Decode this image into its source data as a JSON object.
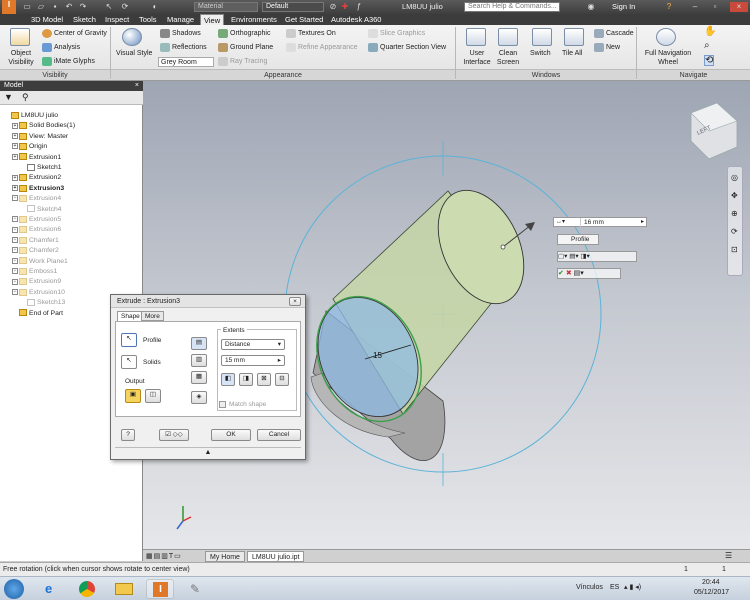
{
  "titlebar": {
    "style_field": "Material",
    "appearance_field": "Default",
    "doc_title": "LM8UU julio",
    "search_placeholder": "Search Help & Commands...",
    "sign_in": "Sign In",
    "help": "?"
  },
  "menu_tabs": [
    "3D Model",
    "Sketch",
    "Inspect",
    "Tools",
    "Manage",
    "View",
    "Environments",
    "Get Started",
    "Autodesk A360"
  ],
  "active_tab": "View",
  "ribbon": {
    "visibility": {
      "object_visibility": "Object Visibility",
      "center_of_gravity": "Center of Gravity",
      "analysis": "Analysis",
      "imate_glyphs": "iMate Glyphs",
      "label": "Visibility"
    },
    "appearance": {
      "visual_style": "Visual Style",
      "shadows": "Shadows",
      "reflections": "Reflections",
      "grey_room": "Grey Room",
      "orthographic": "Orthographic",
      "ground_plane": "Ground Plane",
      "ray_tracing": "Ray Tracing",
      "textures_on": "Textures On",
      "refine_appearance": "Refine Appearance",
      "slice_graphics": "Slice Graphics",
      "quarter_section_view": "Quarter Section View",
      "label": "Appearance"
    },
    "windows": {
      "user_interface": "User Interface",
      "clean_screen": "Clean Screen",
      "switch": "Switch",
      "tile_all": "Tile All",
      "cascade": "Cascade",
      "new": "New",
      "label": "Windows"
    },
    "navigate": {
      "full_navigation_wheel": "Full Navigation Wheel",
      "label": "Navigate"
    }
  },
  "browser": {
    "title": "Model",
    "items": [
      {
        "label": "LM8UU julio",
        "depth": 0,
        "style": "normal"
      },
      {
        "label": "Solid Bodies(1)",
        "depth": 1,
        "style": "normal"
      },
      {
        "label": "View: Master",
        "depth": 1,
        "style": "normal"
      },
      {
        "label": "Origin",
        "depth": 1,
        "style": "normal"
      },
      {
        "label": "Extrusion1",
        "depth": 1,
        "style": "normal"
      },
      {
        "label": "Sketch1",
        "depth": 2,
        "style": "normal"
      },
      {
        "label": "Extrusion2",
        "depth": 1,
        "style": "normal"
      },
      {
        "label": "Extrusion3",
        "depth": 1,
        "style": "bold"
      },
      {
        "label": "Extrusion4",
        "depth": 1,
        "style": "dim"
      },
      {
        "label": "Sketch4",
        "depth": 2,
        "style": "dim"
      },
      {
        "label": "Extrusion5",
        "depth": 1,
        "style": "dim"
      },
      {
        "label": "Extrusion6",
        "depth": 1,
        "style": "dim"
      },
      {
        "label": "Chamfer1",
        "depth": 1,
        "style": "dim"
      },
      {
        "label": "Chamfer2",
        "depth": 1,
        "style": "dim"
      },
      {
        "label": "Work Plane1",
        "depth": 1,
        "style": "dim"
      },
      {
        "label": "Emboss1",
        "depth": 1,
        "style": "dim"
      },
      {
        "label": "Extrusion9",
        "depth": 1,
        "style": "dim"
      },
      {
        "label": "Extrusion10",
        "depth": 1,
        "style": "dim"
      },
      {
        "label": "Sketch13",
        "depth": 2,
        "style": "dim"
      },
      {
        "label": "End of Part",
        "depth": 1,
        "style": "normal"
      }
    ]
  },
  "dialog": {
    "title": "Extrude : Extrusion3",
    "tabs": [
      "Shape",
      "More"
    ],
    "active_tab": "Shape",
    "profile_label": "Profile",
    "solids_label": "Solids",
    "output_label": "Output",
    "extents_label": "Extents",
    "extents_value": "Distance",
    "distance_value": "15 mm",
    "match_shape": "Match shape",
    "ok": "OK",
    "cancel": "Cancel"
  },
  "minitoolbar": {
    "distance_value": "16 mm",
    "profile_label": "Profile"
  },
  "viewport": {
    "dimension_label": "15",
    "viewcube_label": "LEFT"
  },
  "doc_tabs": [
    "My Home",
    "LM8UU julio.ipt"
  ],
  "status": {
    "message": "Free rotation (click when cursor shows rotate to center view)",
    "count_a": "1",
    "count_b": "1"
  },
  "taskbar": {
    "tray_label": "Vínculos",
    "lang": "ES",
    "time": "20:44",
    "date": "05/12/2017"
  }
}
